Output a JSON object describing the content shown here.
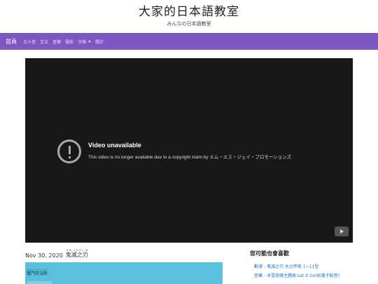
{
  "header": {
    "title": "大家的日本語教室",
    "subtitle": "みんなの日本語教室"
  },
  "nav": {
    "home": "首頁",
    "items": [
      "五十音",
      "文法",
      "音樂",
      "電影",
      "字典",
      "關於"
    ]
  },
  "video": {
    "status_title": "Video unavailable",
    "status_message": "This video is no longer available due to a copyright claim by エム・エス・ジェイ・プロモーションズ"
  },
  "post": {
    "date": "Nov 30, 2020",
    "title": "鬼滅之刃",
    "title_ruby": "きめつのやいば",
    "lyrics_first_line": "竈門炭治郎",
    "lyrics_first_line_ruby": "かまどたんじろう"
  },
  "sidebar": {
    "heading": "您可能也會喜歡",
    "recommendations": [
      "動漫 - 鬼滅之刃 水之呼吸 1~11型",
      "音樂 - 冰雪奇緣主題曲 Let It Go(松隆子配音)"
    ]
  },
  "colors": {
    "nav_bg": "#7e57c2",
    "video_bg": "#181818",
    "lyrics_bg": "#5bc0de",
    "link": "#1a73c8"
  }
}
